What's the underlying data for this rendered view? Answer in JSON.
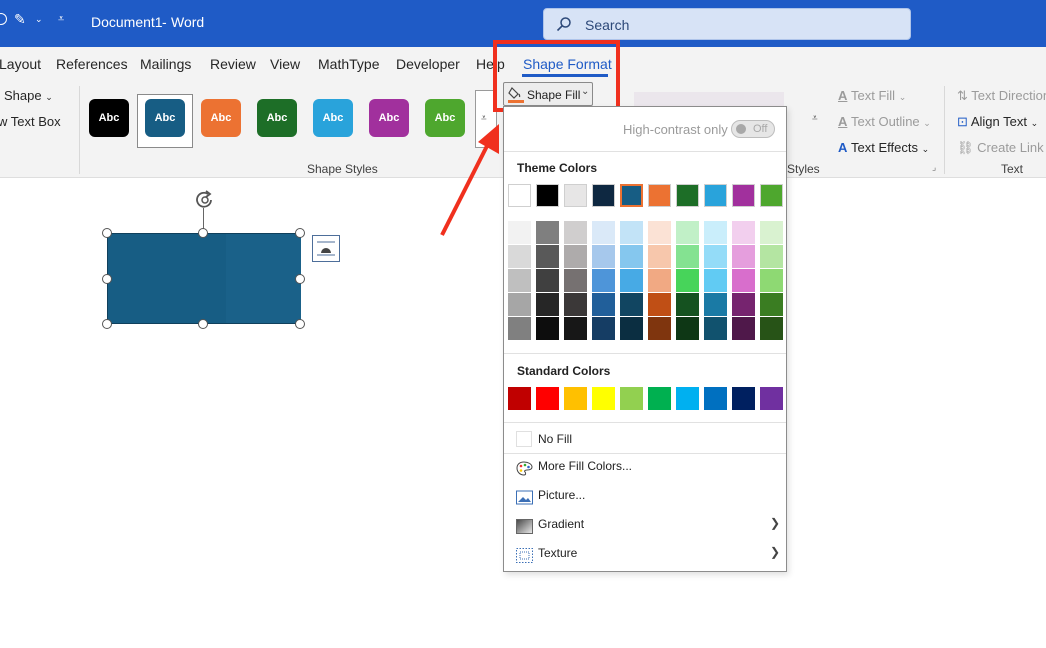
{
  "titlebar": {
    "doc_title": "Document1",
    "separator": "-",
    "app_name": "Word",
    "search_placeholder": "Search",
    "colors": {
      "bar": "#1f5bc6"
    }
  },
  "tabs": [
    {
      "label": "Layout"
    },
    {
      "label": "References"
    },
    {
      "label": "Mailings"
    },
    {
      "label": "Review"
    },
    {
      "label": "View"
    },
    {
      "label": "MathType"
    },
    {
      "label": "Developer"
    },
    {
      "label": "Help"
    },
    {
      "label": "Shape Format",
      "active": true
    }
  ],
  "ribbon": {
    "insert_shapes": {
      "shape_label": "Shape",
      "text_box_label": "w Text Box"
    },
    "shape_styles": {
      "group_label": "Shape Styles",
      "swatch_text": "Abc",
      "swatches": [
        {
          "color": "#000000"
        },
        {
          "color": "#175d84",
          "selected": true
        },
        {
          "color": "#ec7232"
        },
        {
          "color": "#1d6e27"
        },
        {
          "color": "#29a3db"
        },
        {
          "color": "#a1309d"
        },
        {
          "color": "#4ea72e"
        }
      ],
      "shape_fill_label": "Shape Fill",
      "fill_color": "#ec7232"
    },
    "wordart": {
      "group_label_partial": "Styles",
      "text_fill": "Text Fill",
      "text_outline": "Text Outline",
      "text_effects": "Text Effects"
    },
    "text": {
      "group_label": "Text",
      "text_direction": "Text Direction",
      "align_text": "Align Text",
      "create_link": "Create Link"
    }
  },
  "dropdown": {
    "high_contrast_label": "High-contrast only",
    "toggle_state": "Off",
    "theme_colors_label": "Theme Colors",
    "theme_top_row": [
      "#ffffff",
      "#000000",
      "#e7e6e6",
      "#0e2841",
      "#175d84",
      "#ec7232",
      "#1d6e27",
      "#29a3db",
      "#a1309d",
      "#4ea72e"
    ],
    "theme_shades": [
      [
        "#f2f2f2",
        "#d9d9d9",
        "#bfbfbf",
        "#a6a6a6",
        "#808080"
      ],
      [
        "#7f7f7f",
        "#595959",
        "#404040",
        "#262626",
        "#0d0d0d"
      ],
      [
        "#d0cece",
        "#aeabab",
        "#767171",
        "#3b3838",
        "#171717"
      ],
      [
        "#dae9f8",
        "#a6c8ec",
        "#4e95d9",
        "#215f9a",
        "#153d64"
      ],
      [
        "#c2e3f7",
        "#85c7ee",
        "#47aae5",
        "#114561",
        "#0b2e41"
      ],
      [
        "#fbe2d5",
        "#f7c7ac",
        "#f1a983",
        "#c04f15",
        "#7f350e"
      ],
      [
        "#c1f0c7",
        "#84e291",
        "#47d45a",
        "#155220",
        "#0e3715"
      ],
      [
        "#caeefb",
        "#94dcf8",
        "#61cbf3",
        "#1a7aa5",
        "#11526e"
      ],
      [
        "#f2cfee",
        "#e59edd",
        "#d86ecc",
        "#76246f",
        "#4f184a"
      ],
      [
        "#d9f2d0",
        "#b4e5a2",
        "#8ed973",
        "#3a7d22",
        "#275317"
      ]
    ],
    "standard_colors_label": "Standard Colors",
    "standard_colors": [
      "#c00000",
      "#ff0000",
      "#ffc000",
      "#ffff00",
      "#92d050",
      "#00b050",
      "#00b0f0",
      "#0070c0",
      "#002060",
      "#7030a0"
    ],
    "no_fill": "No Fill",
    "more_fill_colors": "More Fill Colors...",
    "picture": "Picture...",
    "gradient": "Gradient",
    "texture": "Texture"
  },
  "document": {
    "shape_color": "#175d84"
  }
}
